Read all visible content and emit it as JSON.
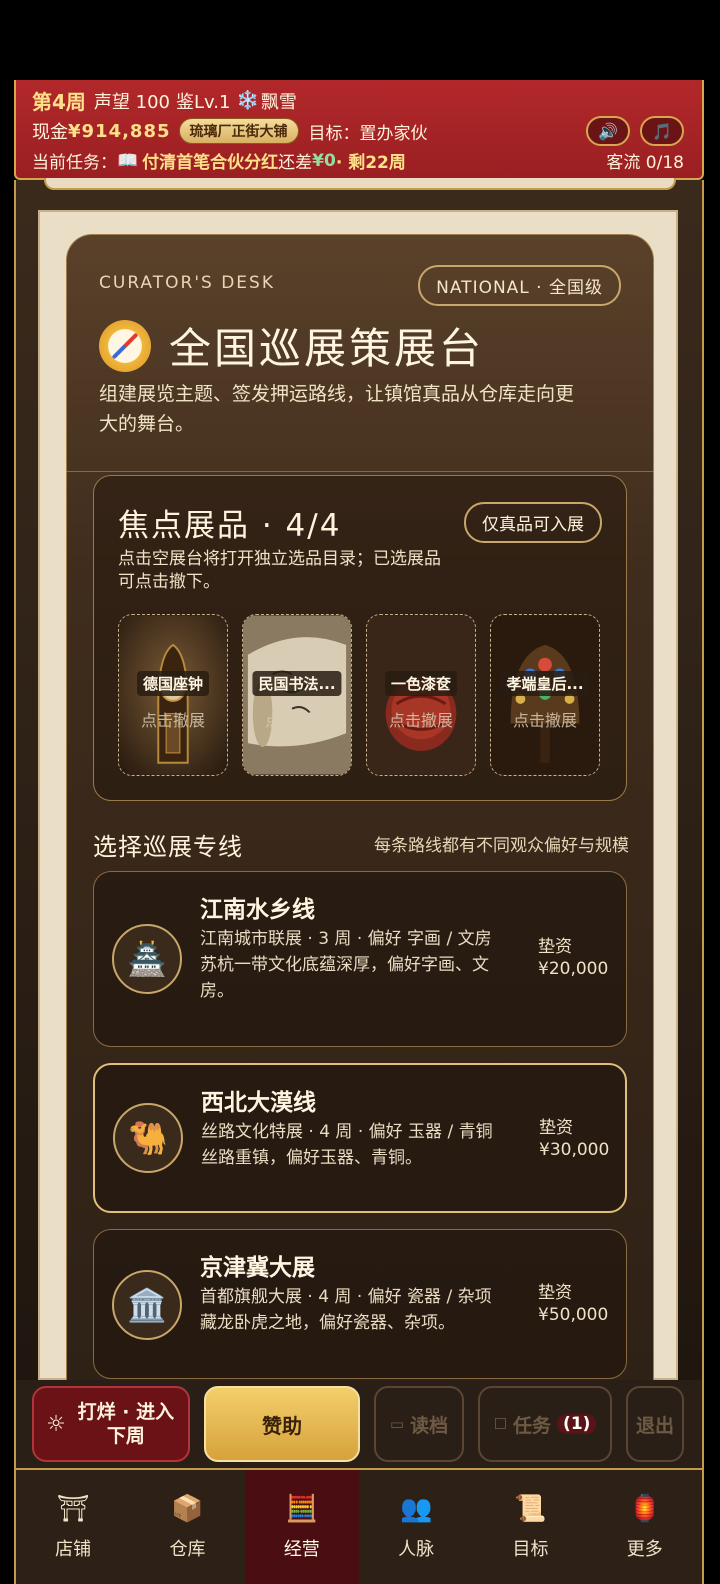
{
  "hud": {
    "week": "第4周",
    "reputation": "声望 100",
    "appraise": "鉴Lv.1",
    "weather_icon": "❄️",
    "weather": "飘雪",
    "cash_label": "现金",
    "cash": "¥914,885",
    "shop": "琉璃厂正街大铺",
    "goal": "目标：置办家伙",
    "task_label": "当前任务：",
    "task_icon": "📖",
    "task": "付清首笔合伙分红",
    "task_remain": "还差",
    "task_amount": "¥0",
    "task_weeks": "· 剩22周",
    "sound_icon": "🔊",
    "music_icon": "🎵",
    "visitors": "客流 0/18"
  },
  "desk": {
    "eyebrow": "CURATOR'S DESK",
    "level": "NATIONAL · 全国级",
    "title": "全国巡展策展台",
    "intro": "组建展览主题、签发押运路线，让镇馆真品从仓库走向更大的舞台。"
  },
  "focus": {
    "title": "焦点展品 · 4/4",
    "only_genuine": "仅真品可入展",
    "hint": "点击空展台将打开独立选品目录；已选展品可点击撤下。",
    "items": [
      {
        "name": "德国座钟",
        "action": "点击撤展"
      },
      {
        "name": "民国书法...",
        "action": "点击撤展"
      },
      {
        "name": "一色漆奁",
        "action": "点击撤展"
      },
      {
        "name": "孝端皇后...",
        "action": "点击撤展"
      }
    ]
  },
  "routes_header": {
    "title": "选择巡展专线",
    "note": "每条路线都有不同观众偏好与规模"
  },
  "routes": [
    {
      "icon": "🏯",
      "name": "江南水乡线",
      "desc1": "江南城市联展 · 3 周 · 偏好 字画 / 文房",
      "desc2": "苏杭一带文化底蕴深厚，偏好字画、文房。",
      "fund_label": "垫资",
      "fund": "¥20,000"
    },
    {
      "icon": "🐫",
      "name": "西北大漠线",
      "desc1": "丝路文化特展 · 4 周 · 偏好 玉器 / 青铜",
      "desc2": "丝路重镇，偏好玉器、青铜。",
      "fund_label": "垫资",
      "fund": "¥30,000"
    },
    {
      "icon": "🏛️",
      "name": "京津冀大展",
      "desc1": "首都旗舰大展 · 4 周 · 偏好 瓷器 / 杂项",
      "desc2": "藏龙卧虎之地，偏好瓷器、杂项。",
      "fund_label": "垫资",
      "fund": "¥50,000"
    }
  ],
  "actions": {
    "next_icon": "☼",
    "next": "打烊 · 进入下周",
    "sponsor": "赞助",
    "load": "读档",
    "task": "任务",
    "task_count": "(1)",
    "quit": "退出"
  },
  "tabs": [
    {
      "icon": "⛩",
      "label": "店铺"
    },
    {
      "icon": "📦",
      "label": "仓库"
    },
    {
      "icon": "🧮",
      "label": "经营"
    },
    {
      "icon": "👥",
      "label": "人脉"
    },
    {
      "icon": "📜",
      "label": "目标"
    },
    {
      "icon": "🏮",
      "label": "更多"
    }
  ],
  "active_tab": "经营"
}
